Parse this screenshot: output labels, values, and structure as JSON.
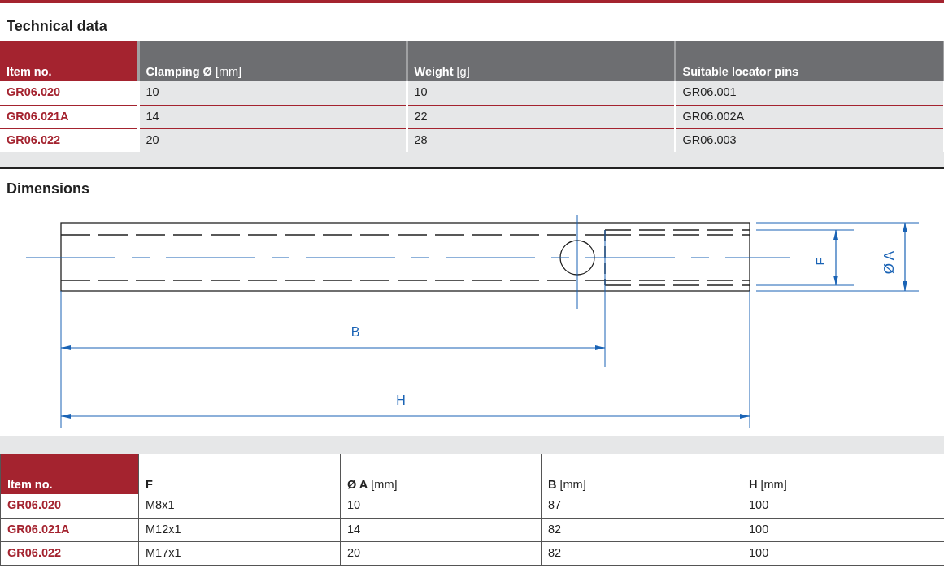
{
  "technical_data": {
    "title": "Technical data",
    "columns": [
      "Item no.",
      "**Clamping Ø** [mm]",
      "**Weight** [g]",
      "**Suitable locator pins**"
    ],
    "rows": [
      [
        "GR06.020",
        "10",
        "10",
        "GR06.001"
      ],
      [
        "GR06.021A",
        "14",
        "22",
        "GR06.002A"
      ],
      [
        "GR06.022",
        "20",
        "28",
        "GR06.003"
      ]
    ]
  },
  "dimensions": {
    "title": "Dimensions",
    "labels": {
      "b": "B",
      "h": "H",
      "f": "F",
      "a": "Ø A"
    }
  },
  "dimension_table": {
    "columns": [
      "Item no.",
      "**F**",
      "**Ø A** [mm]",
      "**B** [mm]",
      "**H** [mm]"
    ],
    "rows": [
      [
        "GR06.020",
        "M8x1",
        "10",
        "87",
        "100"
      ],
      [
        "GR06.021A",
        "M12x1",
        "14",
        "82",
        "100"
      ],
      [
        "GR06.022",
        "M17x1",
        "20",
        "82",
        "100"
      ]
    ]
  }
}
